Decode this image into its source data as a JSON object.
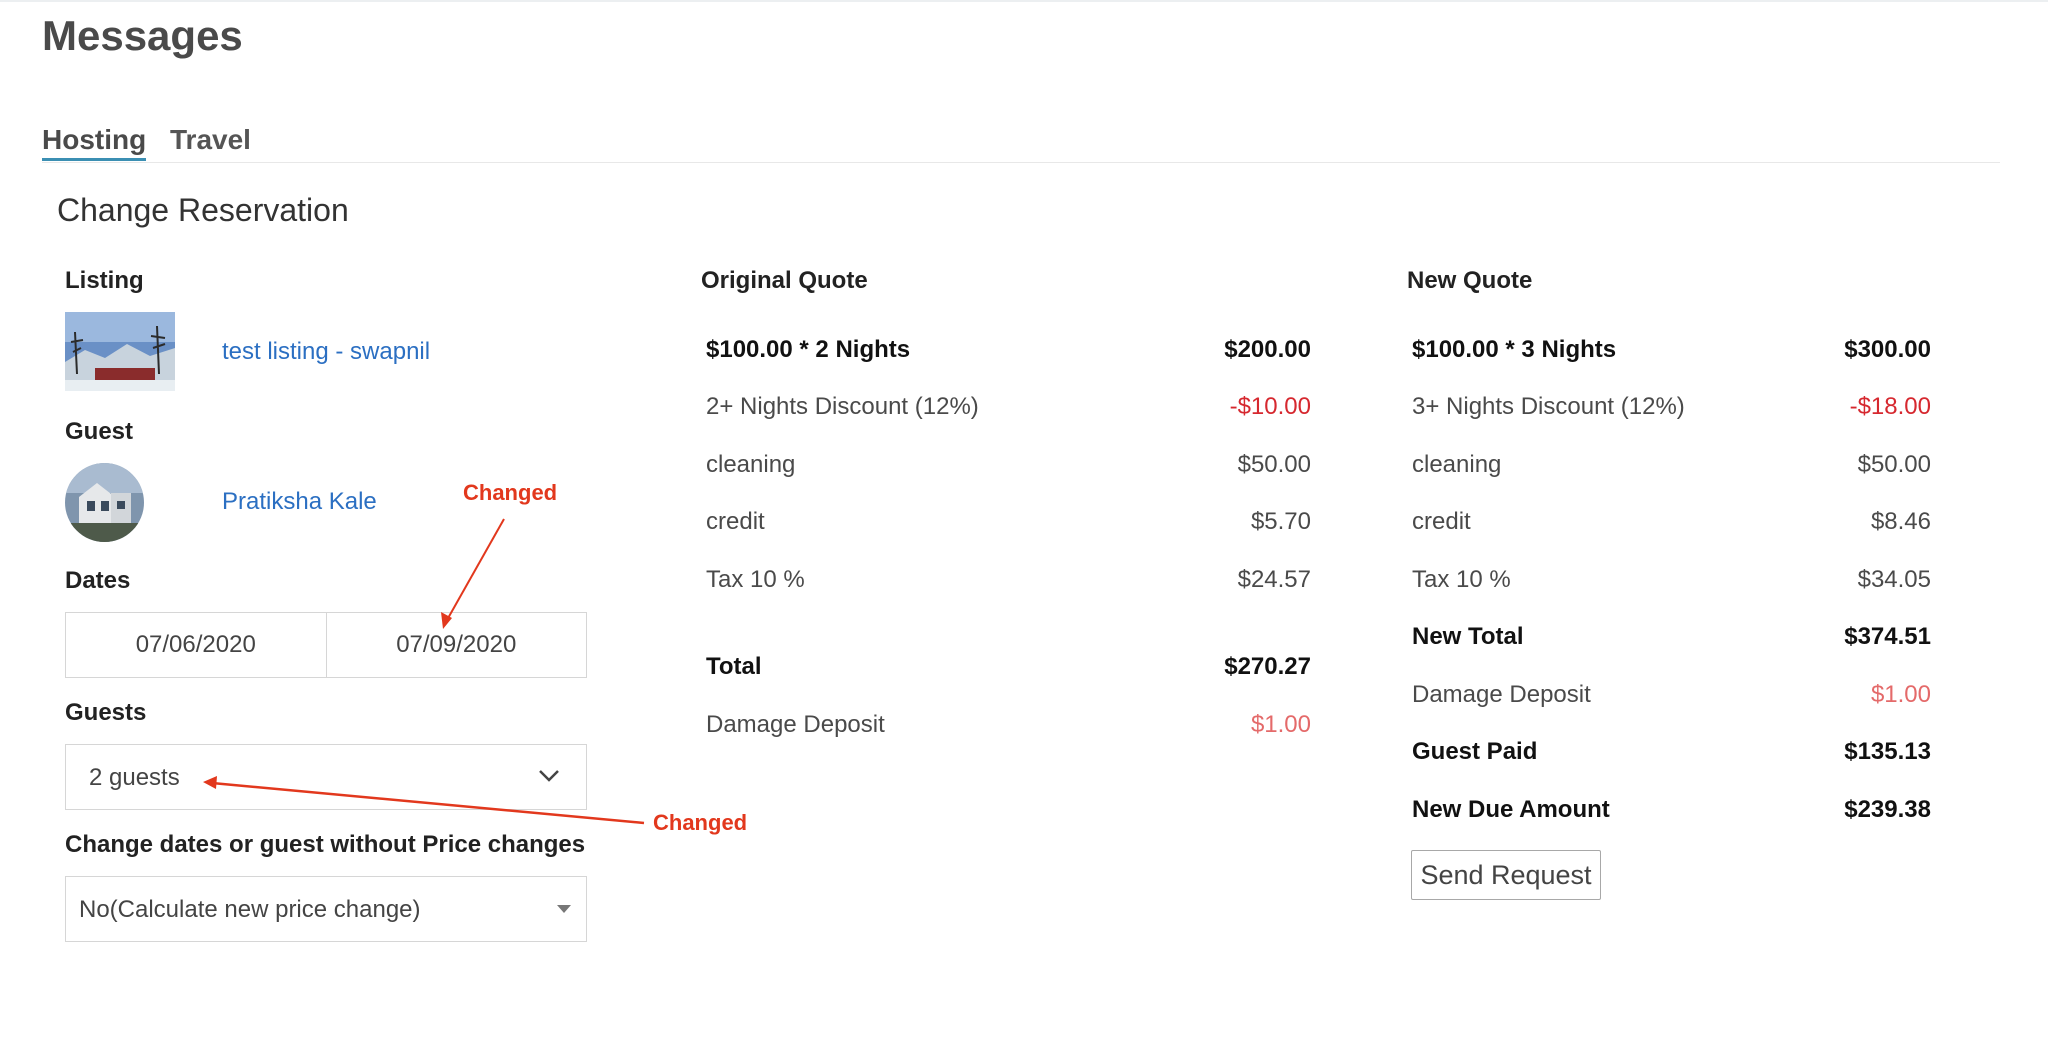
{
  "page": {
    "title": "Messages"
  },
  "tabs": [
    {
      "label": "Hosting"
    },
    {
      "label": "Travel"
    }
  ],
  "form": {
    "title": "Change Reservation",
    "listing_label": "Listing",
    "listing_name": "test listing - swapnil",
    "guest_label": "Guest",
    "guest_name": "Pratiksha Kale",
    "dates_label": "Dates",
    "check_in": "07/06/2020",
    "check_out": "07/09/2020",
    "guests_label": "Guests",
    "guests_value": "2 guests",
    "price_change_label": "Change dates or guest without Price changes",
    "price_change_value": "No(Calculate new price change)"
  },
  "original_quote": {
    "title": "Original Quote",
    "rows": [
      {
        "label": "$100.00 * 2 Nights",
        "value": "$200.00"
      },
      {
        "label": "2+ Nights Discount (12%)",
        "value": "-$10.00"
      },
      {
        "label": "cleaning",
        "value": "$50.00"
      },
      {
        "label": "credit",
        "value": "$5.70"
      },
      {
        "label": "Tax 10 %",
        "value": "$24.57"
      },
      {
        "label": "Total",
        "value": "$270.27"
      },
      {
        "label": "Damage Deposit",
        "value": "$1.00"
      }
    ]
  },
  "new_quote": {
    "title": "New Quote",
    "rows": [
      {
        "label": "$100.00 * 3 Nights",
        "value": "$300.00"
      },
      {
        "label": "3+ Nights Discount (12%)",
        "value": "-$18.00"
      },
      {
        "label": "cleaning",
        "value": "$50.00"
      },
      {
        "label": "credit",
        "value": "$8.46"
      },
      {
        "label": "Tax 10 %",
        "value": "$34.05"
      },
      {
        "label": "New Total",
        "value": "$374.51"
      },
      {
        "label": "Damage Deposit",
        "value": "$1.00"
      },
      {
        "label": "Guest Paid",
        "value": "$135.13"
      },
      {
        "label": "New Due Amount",
        "value": "$239.38"
      }
    ],
    "send_label": "Send Request"
  },
  "annotations": {
    "dates_note": "Changed",
    "guests_note": "Changed"
  },
  "colors": {
    "link": "#2b6fc2",
    "negative": "#d6282f",
    "deposit": "#e46a6a",
    "annotation": "#e2381d",
    "tab_underline": "#3b8fb3"
  },
  "icons": {
    "guests_select": "chevron-down-icon",
    "price_select": "caret-down-icon"
  }
}
